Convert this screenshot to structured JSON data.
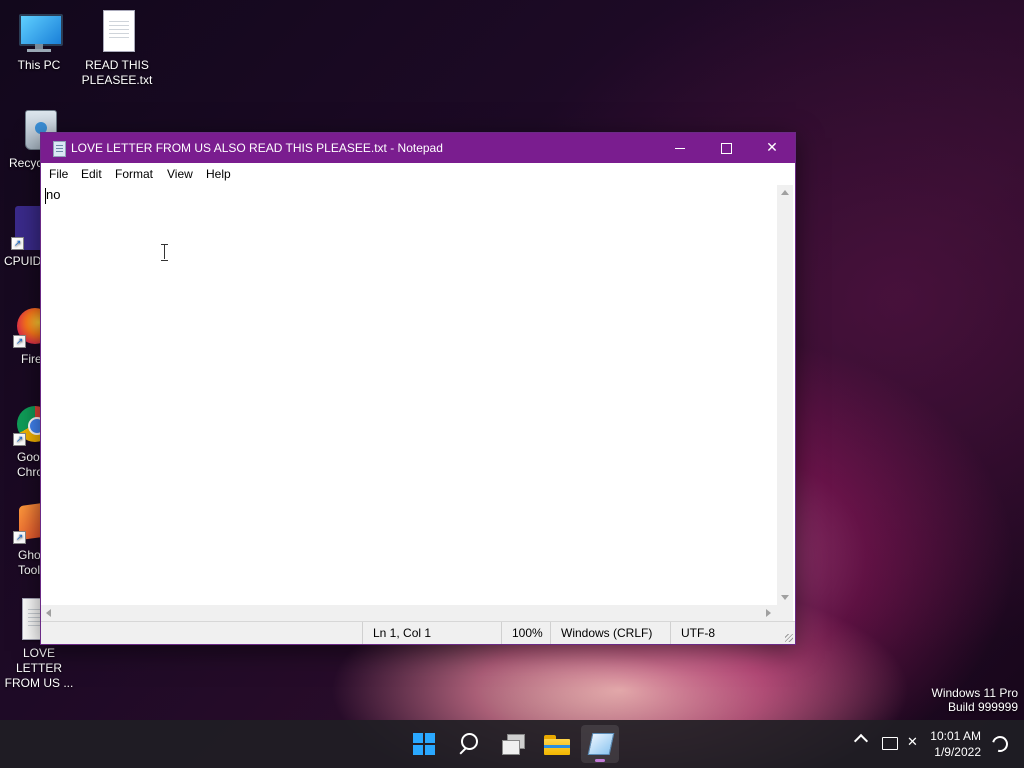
{
  "desktop": {
    "icons": [
      {
        "label": "This PC"
      },
      {
        "label": "READ THIS PLEASEE.txt"
      },
      {
        "label": "Recyc"
      },
      {
        "label": "CPUID"
      },
      {
        "label": "Fire"
      },
      {
        "label": "Goo Chro"
      },
      {
        "label": "Gho Tool"
      },
      {
        "label": "LOVE LETTER FROM US ..."
      }
    ],
    "watermark": {
      "line1": "Windows 11 Pro",
      "line2": "Build 999999"
    }
  },
  "notepad": {
    "title": "LOVE LETTER FROM US ALSO READ THIS PLEASEE.txt - Notepad",
    "menu": [
      "File",
      "Edit",
      "Format",
      "View",
      "Help"
    ],
    "content": "no",
    "status": {
      "position": "Ln 1, Col 1",
      "zoom": "100%",
      "line_ending": "Windows (CRLF)",
      "encoding": "UTF-8"
    },
    "titlebar_color": "#7a1d8f"
  },
  "taskbar": {
    "apps": [
      "start-icon",
      "search-icon",
      "task-view-icon",
      "file-explorer-icon",
      "notepad-icon"
    ],
    "clock": {
      "time": "10:01 AM",
      "date": "1/9/2022"
    }
  }
}
